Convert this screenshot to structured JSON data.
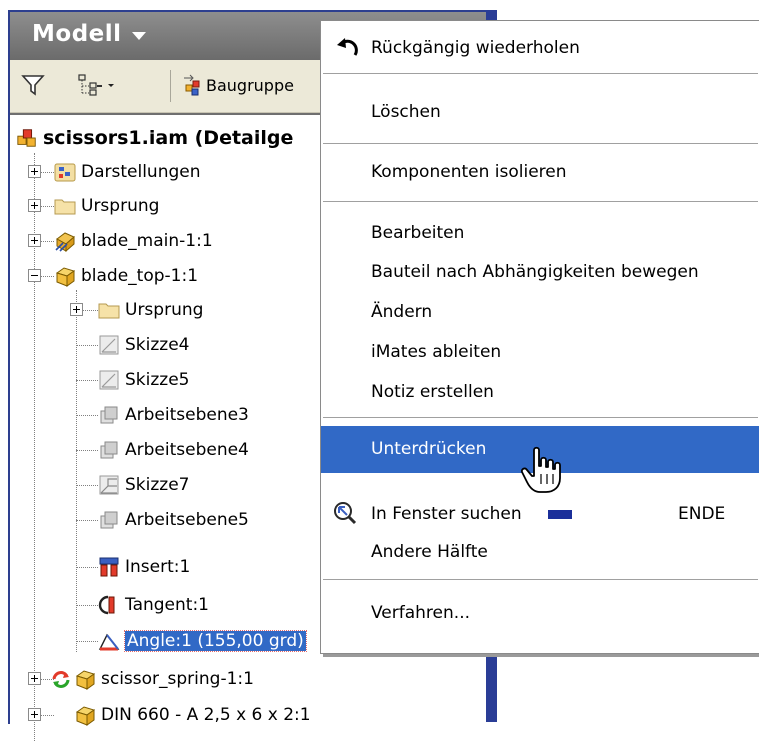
{
  "panel": {
    "title": "Modell",
    "toolbar": {
      "assembly_label": "Baugruppe"
    }
  },
  "tree": {
    "root": "scissors1.iam (Detailge",
    "items": [
      {
        "label": "Darstellungen",
        "icon": "representations-icon",
        "expander": "plus"
      },
      {
        "label": "Ursprung",
        "icon": "folder-icon",
        "expander": "plus"
      },
      {
        "label": "blade_main-1:1",
        "icon": "grounded-part-icon",
        "expander": "plus"
      },
      {
        "label": "blade_top-1:1",
        "icon": "part-icon",
        "expander": "minus"
      },
      {
        "label": "Ursprung",
        "icon": "folder-icon",
        "expander": "plus"
      },
      {
        "label": "Skizze4",
        "icon": "sketch-icon"
      },
      {
        "label": "Skizze5",
        "icon": "sketch-icon"
      },
      {
        "label": "Arbeitsebene3",
        "icon": "work-plane-icon"
      },
      {
        "label": "Arbeitsebene4",
        "icon": "work-plane-icon"
      },
      {
        "label": "Skizze7",
        "icon": "sketch-3d-icon"
      },
      {
        "label": "Arbeitsebene5",
        "icon": "work-plane-icon"
      },
      {
        "label": "Insert:1",
        "icon": "insert-constraint-icon"
      },
      {
        "label": "Tangent:1",
        "icon": "tangent-constraint-icon"
      },
      {
        "label": "Angle:1 (155,00 grd)",
        "icon": "angle-constraint-icon"
      },
      {
        "label": "scissor_spring-1:1",
        "icon": "adaptive-part-icon",
        "expander": "plus"
      },
      {
        "label": "DIN 660 - A 2,5 x 6 x 2:1",
        "icon": "part-icon",
        "expander": "plus"
      }
    ]
  },
  "context_menu": {
    "items": [
      {
        "label": "Rückgängig wiederholen",
        "icon": "undo-icon"
      },
      {
        "label": "Löschen"
      },
      {
        "label": "Komponenten isolieren"
      },
      {
        "label": "Bearbeiten"
      },
      {
        "label": "Bauteil nach Abhängigkeiten bewegen"
      },
      {
        "label": "Ändern"
      },
      {
        "label": "iMates ableiten"
      },
      {
        "label": "Notiz erstellen"
      },
      {
        "label": "Unterdrücken",
        "highlighted": true
      },
      {
        "label": "In Fenster suchen",
        "icon": "find-in-window-icon",
        "shortcut": "ENDE"
      },
      {
        "label": "Andere Hälfte"
      },
      {
        "label": "Verfahren..."
      }
    ]
  },
  "colors": {
    "highlight": "#3169c6",
    "selection_text_bg": "#3169c6",
    "panel_border": "#2a3d96",
    "titlebar": "#7a7a7a"
  }
}
